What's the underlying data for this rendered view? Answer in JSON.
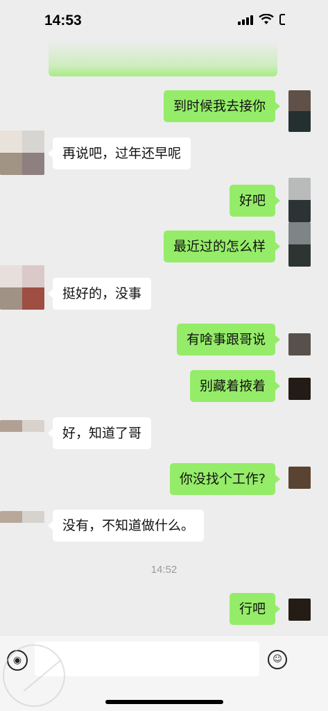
{
  "status_bar": {
    "time": "14:53"
  },
  "messages": [
    {
      "side": "out",
      "text": "到时候我去接你"
    },
    {
      "side": "in",
      "text": "再说吧，过年还早呢"
    },
    {
      "side": "out",
      "text": "好吧"
    },
    {
      "side": "out",
      "text": "最近过的怎么样"
    },
    {
      "side": "in",
      "text": "挺好的，没事"
    },
    {
      "side": "out",
      "text": "有啥事跟哥说"
    },
    {
      "side": "out",
      "text": "别藏着掖着"
    },
    {
      "side": "in",
      "text": "好，知道了哥"
    },
    {
      "side": "out",
      "text": "你没找个工作?"
    },
    {
      "side": "in",
      "text": "没有，不知道做什么。"
    },
    {
      "side": "out",
      "text": "行吧"
    }
  ],
  "timestamp": "14:52",
  "input": {
    "value": ""
  }
}
